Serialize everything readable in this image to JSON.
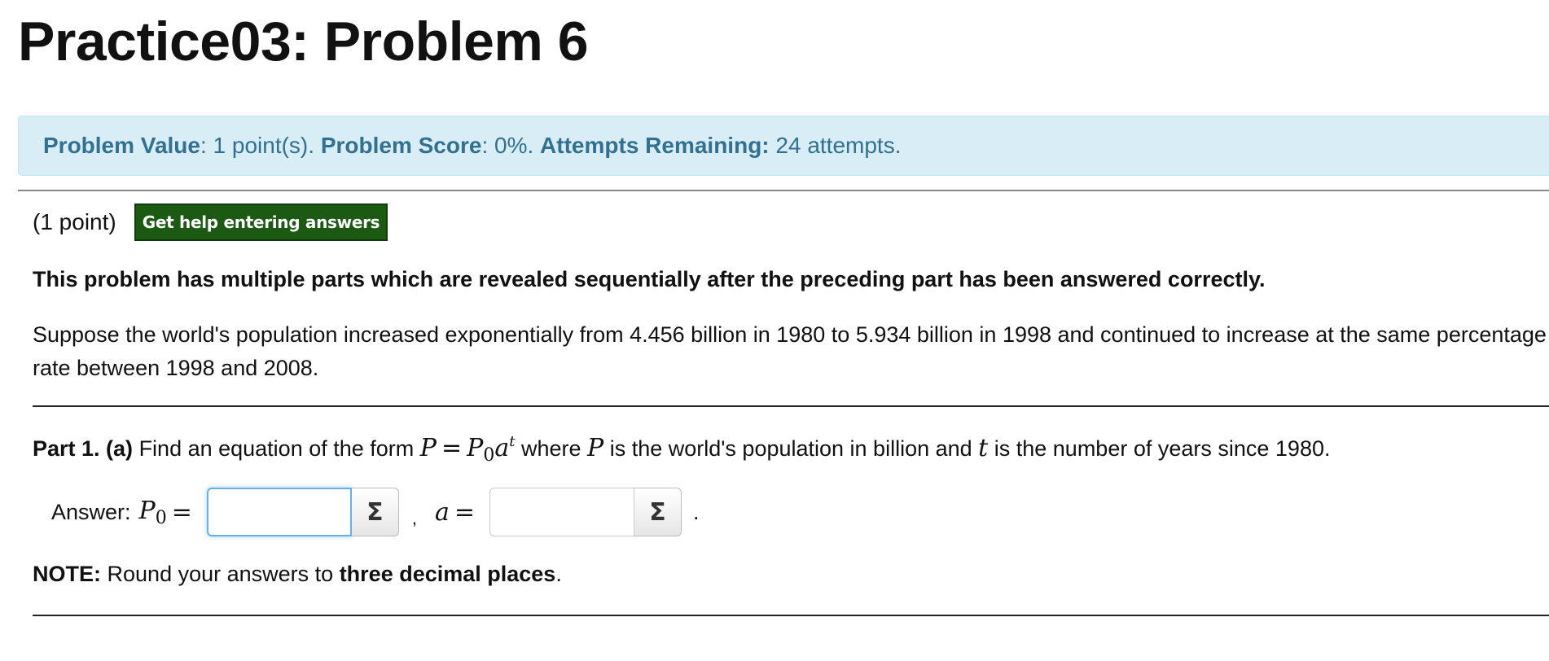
{
  "page": {
    "title": "Practice03: Problem 6"
  },
  "info": {
    "value_label": "Problem Value",
    "value_text": ": 1 point(s).",
    "score_label": "Problem Score",
    "score_text": ": 0%.",
    "attempts_label": "Attempts Remaining:",
    "attempts_text": "24 attempts."
  },
  "problem": {
    "points": "(1 point)",
    "help_button": "Get help entering answers",
    "warning": "This problem has multiple parts which are revealed sequentially after the preceding part has been answered correctly.",
    "statement": "Suppose the world's population increased exponentially from 4.456 billion in 1980 to 5.934 billion in 1998 and continued to increase at the same percentage rate between 1998 and 2008."
  },
  "part1": {
    "label": "Part 1. (a)",
    "text_before": "Find an equation of the form",
    "eq_lhs": "P",
    "eq_equals": "=",
    "eq_p": "P",
    "eq_sub": "0",
    "eq_a": "a",
    "eq_exp": "t",
    "text_where": "where",
    "var_p": "P",
    "text_middle": "is the world's population in billion and",
    "var_t": "t",
    "text_after": "is the number of years since 1980."
  },
  "answer": {
    "label": "Answer:",
    "p0_var": "P",
    "p0_sub": "0",
    "equals": "=",
    "p0_value": "",
    "comma": ",",
    "a_var": "a",
    "a_value": "",
    "sigma": "Σ",
    "period": "."
  },
  "note": {
    "label": "NOTE:",
    "text": "Round your answers to",
    "emphasis": "three decimal places",
    "end": "."
  }
}
